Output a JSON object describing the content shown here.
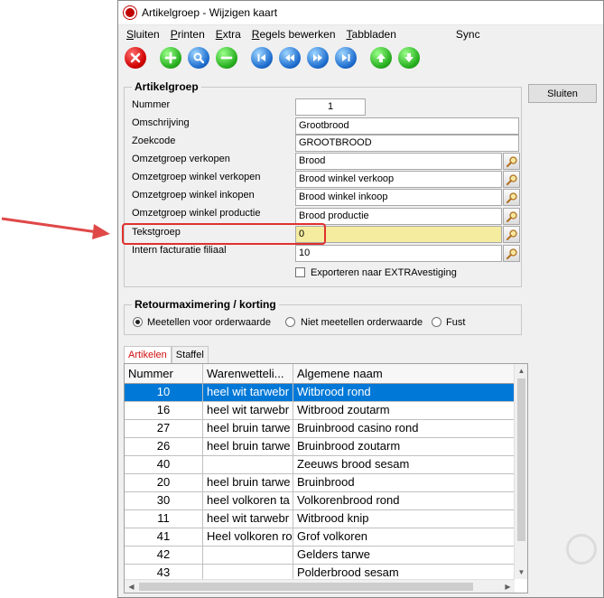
{
  "window": {
    "title": "Artikelgroep - Wijzigen kaart"
  },
  "menu": [
    {
      "pre": "",
      "ul": "S",
      "post": "luiten"
    },
    {
      "pre": "",
      "ul": "P",
      "post": "rinten"
    },
    {
      "pre": "",
      "ul": "E",
      "post": "xtra"
    },
    {
      "pre": "",
      "ul": "R",
      "post": "egels bewerken"
    },
    {
      "pre": "",
      "ul": "T",
      "post": "abbladen"
    }
  ],
  "menu_sync": "Sync",
  "toolbar": {
    "delete": "delete-icon",
    "add": "plus-icon",
    "search": "search-icon",
    "remove": "minus-icon",
    "first": "first-record-icon",
    "prev": "previous-record-icon",
    "next": "next-record-icon",
    "last": "last-record-icon",
    "up": "arrow-up-icon",
    "down": "arrow-down-icon"
  },
  "close_button": "Sluiten",
  "artikelgroep": {
    "legend": "Artikelgroep",
    "nummer_label": "Nummer",
    "nummer": "1",
    "omschrijving_label": "Omschrijving",
    "omschrijving": "Grootbrood",
    "zoekcode_label": "Zoekcode",
    "zoekcode": "GROOTBROOD",
    "omzet_verkopen_label": "Omzetgroep verkopen",
    "omzet_verkopen": "Brood",
    "omzet_winkel_verkopen_label": "Omzetgroep winkel verkopen",
    "omzet_winkel_verkopen": "Brood winkel verkoop",
    "omzet_winkel_inkopen_label": "Omzetgroep winkel inkopen",
    "omzet_winkel_inkopen": "Brood winkel inkoop",
    "omzet_winkel_productie_label": "Omzetgroep winkel productie",
    "omzet_winkel_productie": "Brood productie",
    "tekstgroep_label": "Tekstgroep",
    "tekstgroep": "0",
    "intern_label": "Intern facturatie filiaal",
    "intern": "10",
    "exporteren_label": "Exporteren naar EXTRAvestiging"
  },
  "retour": {
    "legend": "Retourmaximering / korting",
    "opt1": "Meetellen voor orderwaarde",
    "opt2": "Niet meetellen orderwaarde",
    "opt3": "Fust",
    "selected": "Meetellen voor orderwaarde"
  },
  "tabs": [
    "Artikelen",
    "Staffel"
  ],
  "grid": {
    "headers": [
      "Nummer",
      "Warenwetteli...",
      "Algemene naam"
    ],
    "rows": [
      {
        "nummer": "10",
        "waren": "heel wit tarwebr",
        "naam": "Witbrood rond"
      },
      {
        "nummer": "16",
        "waren": "heel wit tarwebr",
        "naam": "Witbrood zoutarm"
      },
      {
        "nummer": "27",
        "waren": "heel bruin tarwe",
        "naam": "Bruinbrood casino rond"
      },
      {
        "nummer": "26",
        "waren": "heel bruin tarwe",
        "naam": "Bruinbrood zoutarm"
      },
      {
        "nummer": "40",
        "waren": "",
        "naam": "Zeeuws brood sesam"
      },
      {
        "nummer": "20",
        "waren": "heel bruin tarwe",
        "naam": "Bruinbrood"
      },
      {
        "nummer": "30",
        "waren": "heel volkoren ta",
        "naam": "Volkorenbrood rond"
      },
      {
        "nummer": "11",
        "waren": "heel wit tarwebr",
        "naam": "Witbrood knip"
      },
      {
        "nummer": "41",
        "waren": "Heel volkoren ro",
        "naam": "Grof volkoren"
      },
      {
        "nummer": "42",
        "waren": "",
        "naam": "Gelders tarwe"
      },
      {
        "nummer": "43",
        "waren": "",
        "naam": "Polderbrood sesam"
      }
    ]
  },
  "colors": {
    "selection": "#0078d7",
    "highlight": "#e03030",
    "yellow_field": "#f5eca0"
  }
}
